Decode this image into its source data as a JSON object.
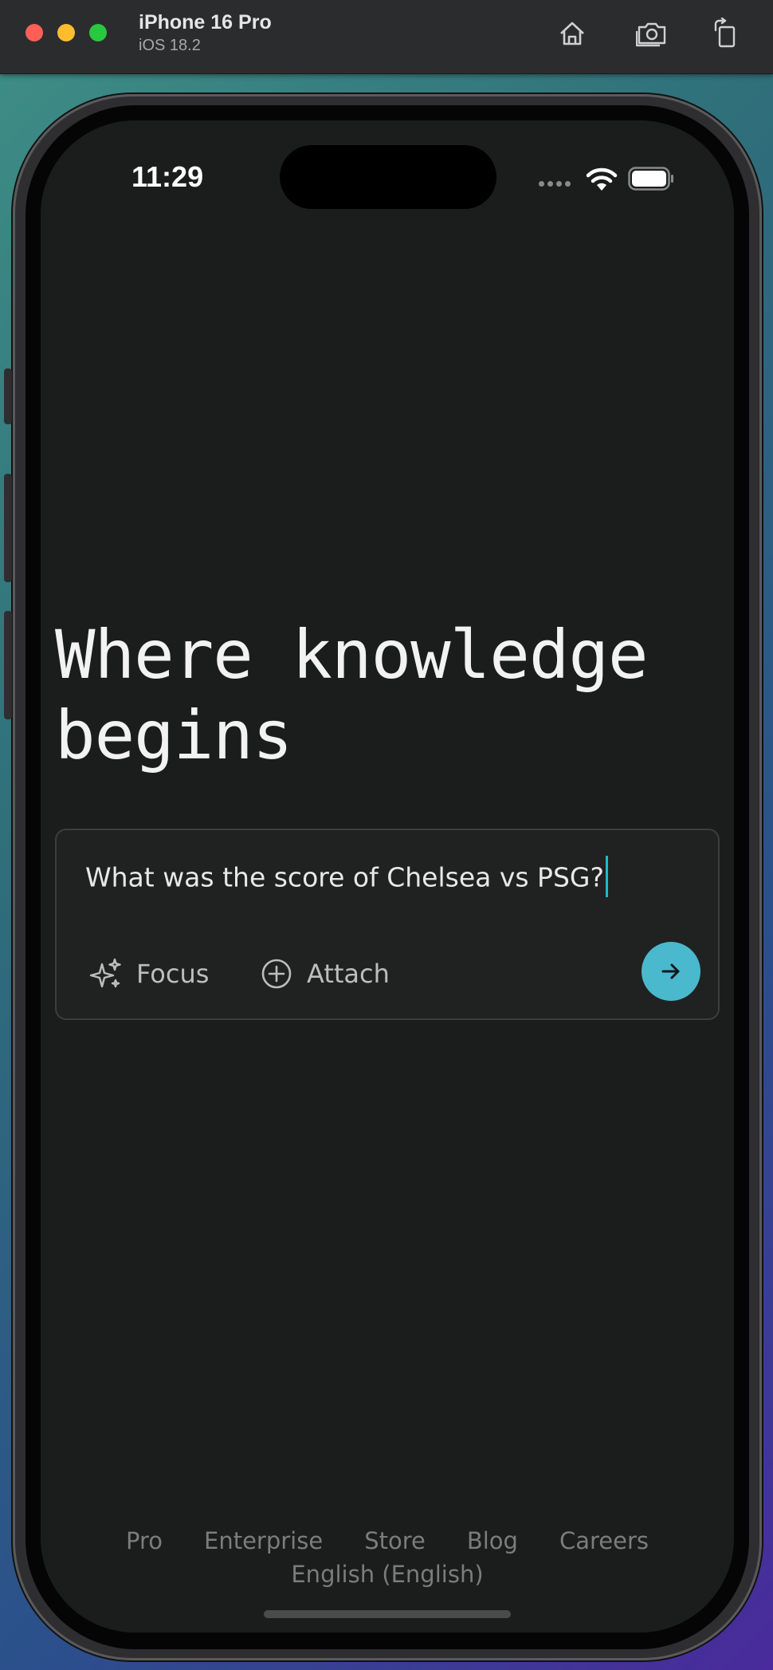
{
  "simulator": {
    "device_name": "iPhone 16 Pro",
    "os_version": "iOS 18.2",
    "icons": [
      "home-icon",
      "screenshot-icon",
      "rotate-icon"
    ]
  },
  "status_bar": {
    "time": "11:29",
    "icons": [
      "cellular-dots-icon",
      "wifi-icon",
      "battery-icon"
    ]
  },
  "hero": {
    "line1": "Where knowledge",
    "line2": "begins"
  },
  "search": {
    "query": "What was the score of Chelsea vs PSG?",
    "focus_label": "Focus",
    "attach_label": "Attach",
    "accent": "#4ab8cd"
  },
  "footer": {
    "links": [
      "Pro",
      "Enterprise",
      "Store",
      "Blog",
      "Careers"
    ],
    "language": "English (English)"
  }
}
